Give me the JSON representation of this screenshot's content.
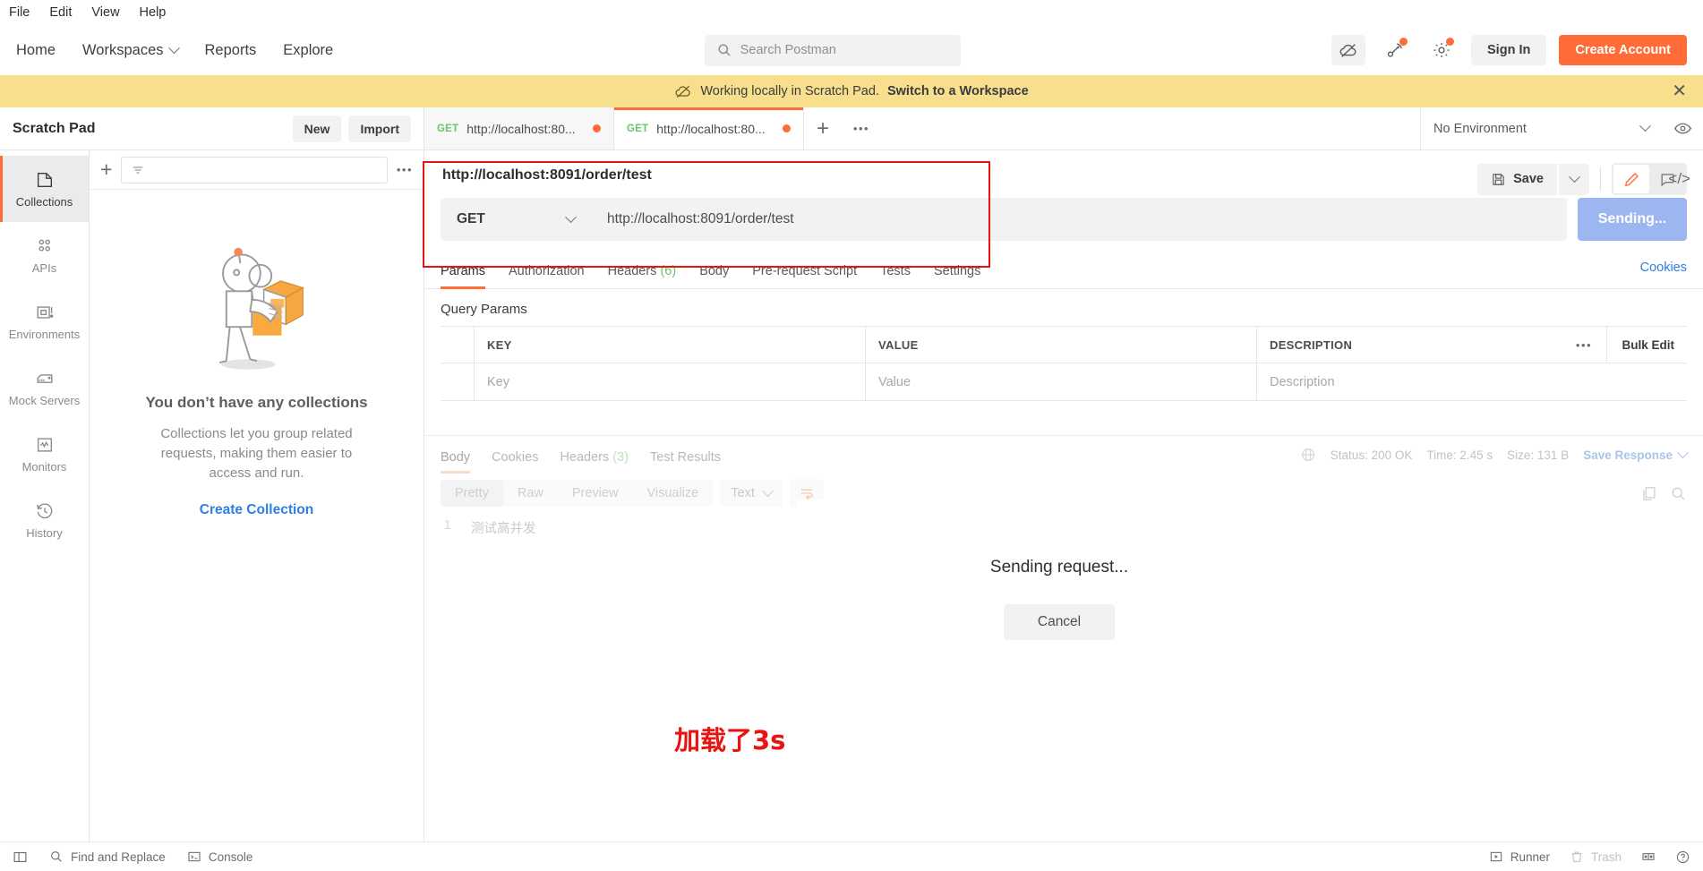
{
  "menubar": {
    "items": [
      "File",
      "Edit",
      "View",
      "Help"
    ]
  },
  "topnav": {
    "links": [
      "Home",
      "Workspaces",
      "Reports",
      "Explore"
    ],
    "search_placeholder": "Search Postman",
    "sign_in_label": "Sign In",
    "create_account_label": "Create Account",
    "accent_color": "#ff6c37"
  },
  "banner": {
    "text": "Working locally in Scratch Pad.",
    "link": "Switch to a Workspace",
    "background": "#f8df8d"
  },
  "workbench": {
    "title": "Scratch Pad",
    "new_label": "New",
    "import_label": "Import",
    "environment": "No Environment",
    "tabs": [
      {
        "method": "GET",
        "name": "http://localhost:80...",
        "unsaved": true,
        "active": false
      },
      {
        "method": "GET",
        "name": "http://localhost:80...",
        "unsaved": true,
        "active": true
      }
    ]
  },
  "rail": {
    "items": [
      {
        "label": "Collections",
        "icon": "collections-icon",
        "active": true
      },
      {
        "label": "APIs",
        "icon": "apis-icon",
        "active": false
      },
      {
        "label": "Environments",
        "icon": "environments-icon",
        "active": false
      },
      {
        "label": "Mock Servers",
        "icon": "mock-servers-icon",
        "active": false
      },
      {
        "label": "Monitors",
        "icon": "monitors-icon",
        "active": false
      },
      {
        "label": "History",
        "icon": "history-icon",
        "active": false
      }
    ]
  },
  "sidebar": {
    "empty_title": "You don’t have any collections",
    "empty_subtitle": "Collections let you group related requests, making them easier to access and run.",
    "create_link": "Create Collection"
  },
  "request": {
    "name": "http://localhost:8091/order/test",
    "method": "GET",
    "url": "http://localhost:8091/order/test",
    "send_label": "Sending...",
    "save_label": "Save",
    "tabs": [
      {
        "label": "Params",
        "count": "",
        "active": true
      },
      {
        "label": "Authorization",
        "count": "",
        "active": false
      },
      {
        "label": "Headers",
        "count": "(6)",
        "active": false
      },
      {
        "label": "Body",
        "count": "",
        "active": false
      },
      {
        "label": "Pre-request Script",
        "count": "",
        "active": false
      },
      {
        "label": "Tests",
        "count": "",
        "active": false
      },
      {
        "label": "Settings",
        "count": "",
        "active": false
      }
    ],
    "cookies_link": "Cookies",
    "query_params_title": "Query Params",
    "table": {
      "headers": [
        "KEY",
        "VALUE",
        "DESCRIPTION"
      ],
      "bulk_edit_label": "Bulk Edit",
      "row_placeholders": [
        "Key",
        "Value",
        "Description"
      ]
    }
  },
  "response": {
    "tabs": [
      {
        "label": "Body",
        "count": "",
        "active": true
      },
      {
        "label": "Cookies",
        "count": "",
        "active": false
      },
      {
        "label": "Headers",
        "count": "(3)",
        "active": false
      },
      {
        "label": "Test Results",
        "count": "",
        "active": false
      }
    ],
    "status": "Status: 200 OK",
    "time": "Time: 2.45 s",
    "size": "Size: 131 B",
    "save_response_label": "Save Response",
    "formats": [
      {
        "label": "Pretty",
        "active": true
      },
      {
        "label": "Raw",
        "active": false
      },
      {
        "label": "Preview",
        "active": false
      },
      {
        "label": "Visualize",
        "active": false
      }
    ],
    "content_type": "Text",
    "body_lines": [
      {
        "number": "1",
        "text": "测试高并发"
      }
    ]
  },
  "modal": {
    "title": "Sending request...",
    "cancel_label": "Cancel"
  },
  "annotation": {
    "note": "加载了3s",
    "color": "#e8140f"
  },
  "statusbar": {
    "left": [
      {
        "label": "",
        "icon": "sidebar-toggle-icon"
      },
      {
        "label": "Find and Replace",
        "icon": "search-icon"
      },
      {
        "label": "Console",
        "icon": "console-icon"
      }
    ],
    "right": [
      {
        "label": "Runner",
        "icon": "runner-icon",
        "dim": false
      },
      {
        "label": "Trash",
        "icon": "trash-icon",
        "dim": true
      },
      {
        "label": "",
        "icon": "layout-icon",
        "dim": false
      },
      {
        "label": "",
        "icon": "help-icon",
        "dim": false
      }
    ]
  }
}
